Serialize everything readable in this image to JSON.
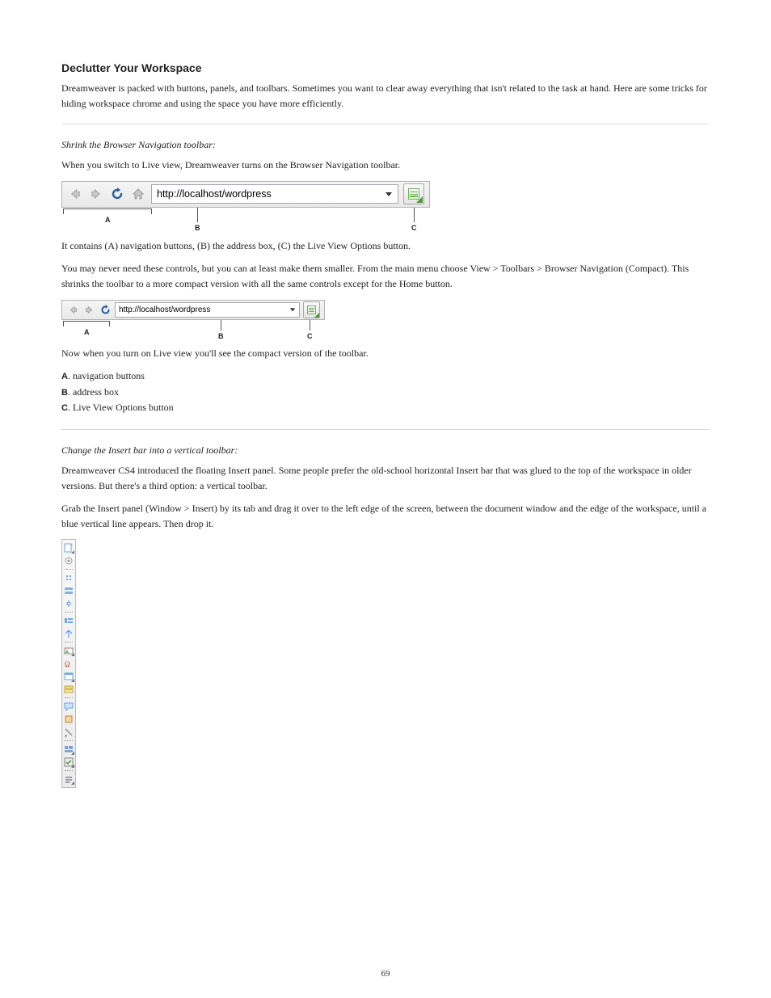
{
  "heading_declutter": "Declutter Your Workspace",
  "para_declutter": "Dreamweaver is packed with buttons, panels, and toolbars. Sometimes you want to clear away everything that isn't related to the task at hand. Here are some tricks for hiding workspace chrome and using the space you have more efficiently.",
  "heading_browser_bar": "Shrink the Browser Navigation toolbar:",
  "para_browser_bar_1": "When you switch to Live view, Dreamweaver turns on the Browser Navigation toolbar.",
  "labels": {
    "A": "A",
    "B": "B",
    "C": "C"
  },
  "url_value": "http://localhost/wordpress",
  "toolbar_large_caption_pre": "It contains ",
  "toolbar_large_caption_items": "(A) navigation buttons, (B) the address box, (C) the Live View Options button",
  "toolbar_large_caption_post": ".",
  "para_browser_bar_2": "You may never need these controls, but you can at least make them smaller. From the main menu choose View > Toolbars > Browser Navigation (Compact). This shrinks the toolbar to a more compact version with all the same controls except for the Home button.",
  "para_browser_bar_3": "Now when you turn on Live view you'll see the compact version of the toolbar.",
  "heading_insert_bar": "Change the Insert bar into a vertical toolbar:",
  "para_insert_bar_1": "Dreamweaver CS4 introduced the floating Insert panel. Some people prefer the old-school horizontal Insert bar that was glued to the top of the workspace in older versions. But there's a third option: a vertical toolbar.",
  "para_insert_bar_2": "Grab the Insert panel (Window > Insert) by its tab and drag it over to the left edge of the screen, between the document window and the edge of the workspace, until a blue vertical line appears. Then drop it.",
  "vtoolbar_icons": [
    "hyperlink-icon",
    "email-link-icon",
    "named-anchor-icon",
    "horizontal-rule-icon",
    "table-icon",
    "insert-div-icon",
    "images-icon",
    "media-icon",
    "widget-icon",
    "date-icon",
    "server-side-include-icon",
    "comment-icon",
    "head-icon",
    "script-icon",
    "templates-icon",
    "tag-chooser-icon",
    "more-icon"
  ],
  "page_number": "69"
}
